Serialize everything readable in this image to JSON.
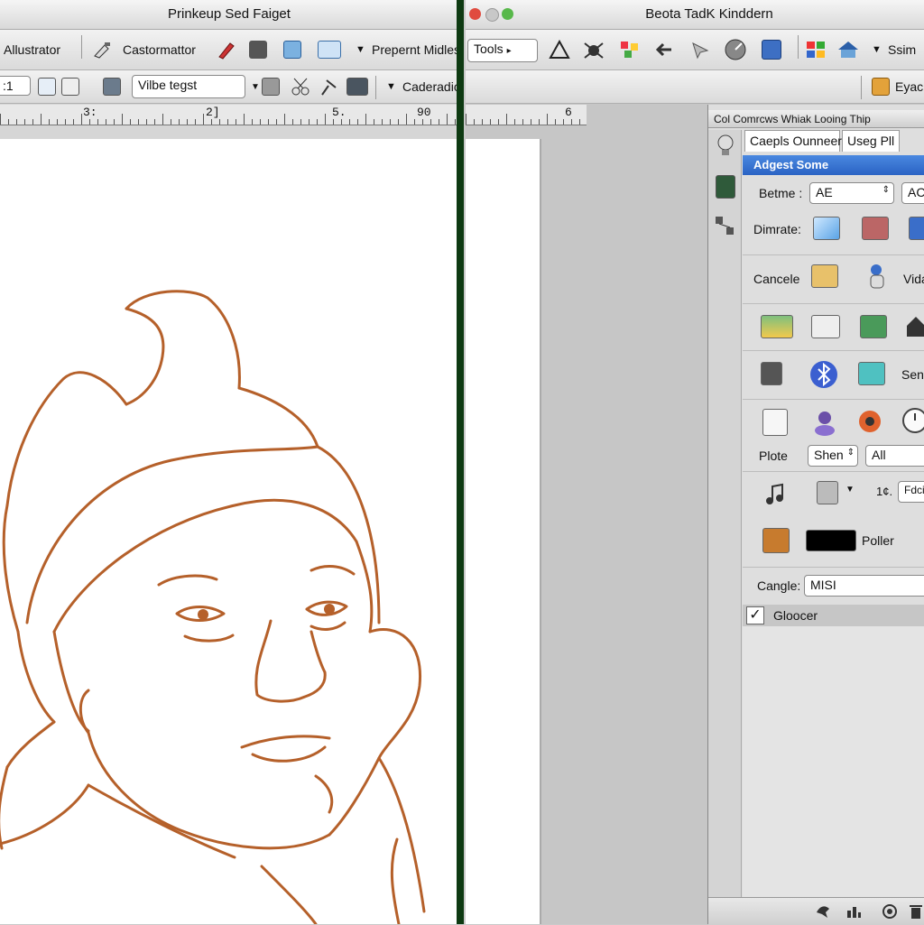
{
  "left_window": {
    "title": "Prinkeup Sed Faiget",
    "toolbar1": {
      "app_label": "Allustrator",
      "castor_label": "Castormattor",
      "present_label": "Prepernt Midles"
    },
    "toolbar2": {
      "zoom_value": ":1",
      "font_field_value": "Vilbe tegst",
      "menu_label": "Caderadic"
    },
    "ruler_labels": [
      "3:",
      "2]",
      "5.",
      "90",
      "6"
    ]
  },
  "right_window": {
    "title": "Beota TadK Kinddern",
    "toolbar1": {
      "tools_label": "Tools",
      "ssim_label": "Ssim"
    },
    "toolbar2": {
      "eyac_label": "Eyac"
    }
  },
  "panel": {
    "header": "Col Comrcws Whiak Looing Thip",
    "tabs": [
      "Caepls Ounneer",
      "Useg Pll"
    ],
    "section_title": "Adgest Some",
    "betme_label": "Betme :",
    "betme_value": "AE",
    "betme_value2": "AC",
    "dimrate_label": "Dimrate:",
    "cancele_label": "Cancele",
    "vida_label": "Vida",
    "senu_label": "Senu",
    "plote_label": "Plote",
    "shen_value": "Shen",
    "all_value": "All",
    "num_label": "1¢.",
    "num_value": "Fdcie",
    "poller_label": "Poller",
    "cangle_label": "Cangle:",
    "cangle_value": "MISI",
    "checkbox_label": "Gloocer",
    "checkbox_checked": true
  },
  "colors": {
    "divider": "#0e3a12",
    "drawing_stroke": "#b5602a",
    "panel_section": "#2f6fd0"
  }
}
